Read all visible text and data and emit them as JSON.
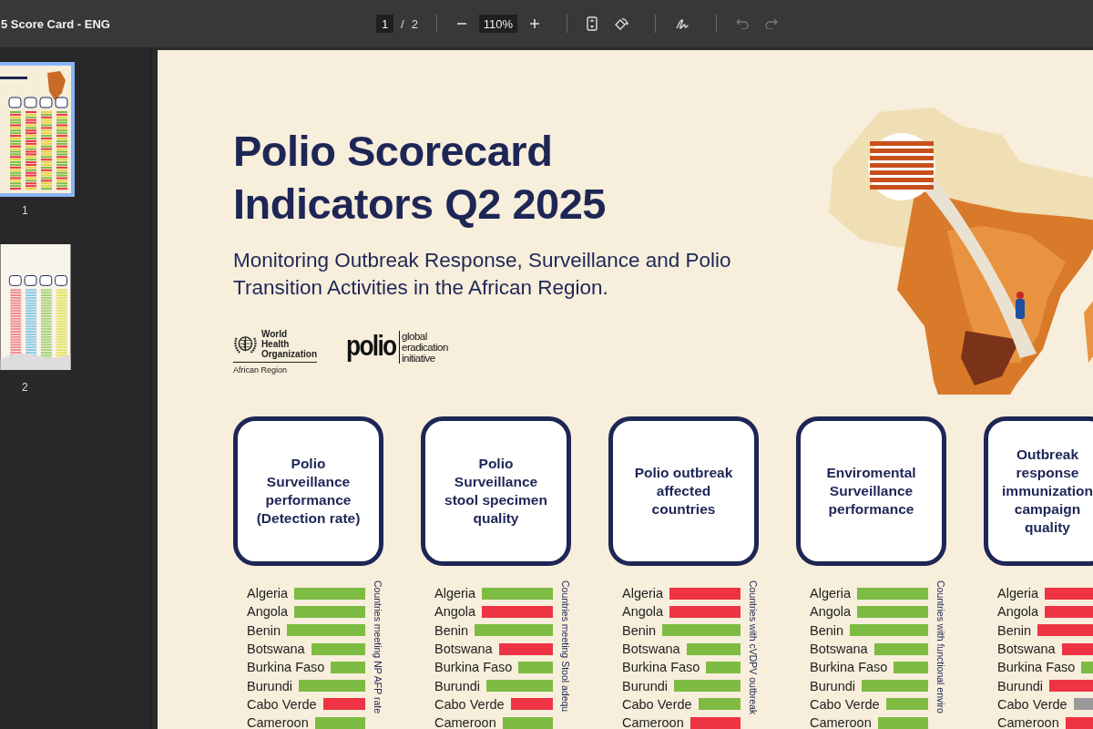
{
  "toolbar": {
    "title": "5 Score Card - ENG",
    "page_input": "1",
    "page_separator": "/",
    "page_count": "2",
    "zoom": "110%",
    "undo_disabled": true,
    "redo_disabled": true
  },
  "thumbnails": [
    {
      "label": "1",
      "selected": true
    },
    {
      "label": "2",
      "selected": false
    }
  ],
  "document": {
    "title_lines": [
      "Polio Scorecard",
      "Indicators Q2 2025"
    ],
    "subtitle_lines": [
      "Monitoring Outbreak Response, Surveillance and Polio",
      "Transition Activities in the African Region."
    ],
    "who_logo": {
      "name_lines": [
        "World Health",
        "Organization"
      ],
      "region": "African Region"
    },
    "gpei_logo": {
      "mark": "polio",
      "name_lines": [
        "global",
        "eradication",
        "initiative"
      ]
    },
    "columns": [
      {
        "title": "Polio Surveillance performance (Detection rate)",
        "side_note": "Countries meeting NP AFP rate",
        "rows": [
          {
            "name": "Algeria",
            "color": "#7dbb42"
          },
          {
            "name": "Angola",
            "color": "#7dbb42"
          },
          {
            "name": "Benin",
            "color": "#7dbb42"
          },
          {
            "name": "Botswana",
            "color": "#7dbb42"
          },
          {
            "name": "Burkina Faso",
            "color": "#7dbb42"
          },
          {
            "name": "Burundi",
            "color": "#7dbb42"
          },
          {
            "name": "Cabo Verde",
            "color": "#ee3444"
          },
          {
            "name": "Cameroon",
            "color": "#7dbb42"
          }
        ]
      },
      {
        "title": "Polio Surveillance stool specimen quality",
        "side_note": "Countries meeting Stool adequ",
        "rows": [
          {
            "name": "Algeria",
            "color": "#7dbb42"
          },
          {
            "name": "Angola",
            "color": "#ee3444"
          },
          {
            "name": "Benin",
            "color": "#7dbb42"
          },
          {
            "name": "Botswana",
            "color": "#ee3444"
          },
          {
            "name": "Burkina Faso",
            "color": "#7dbb42"
          },
          {
            "name": "Burundi",
            "color": "#7dbb42"
          },
          {
            "name": "Cabo Verde",
            "color": "#ee3444"
          },
          {
            "name": "Cameroon",
            "color": "#7dbb42"
          }
        ]
      },
      {
        "title": "Polio outbreak affected countries",
        "side_note": "Countries with cVDPV outbreak",
        "rows": [
          {
            "name": "Algeria",
            "color": "#ee3444"
          },
          {
            "name": "Angola",
            "color": "#ee3444"
          },
          {
            "name": "Benin",
            "color": "#7dbb42"
          },
          {
            "name": "Botswana",
            "color": "#7dbb42"
          },
          {
            "name": "Burkina Faso",
            "color": "#7dbb42"
          },
          {
            "name": "Burundi",
            "color": "#7dbb42"
          },
          {
            "name": "Cabo Verde",
            "color": "#7dbb42"
          },
          {
            "name": "Cameroon",
            "color": "#ee3444"
          }
        ]
      },
      {
        "title": "Enviromental Surveillance performance",
        "side_note": "Countries with functional enviro",
        "rows": [
          {
            "name": "Algeria",
            "color": "#7dbb42"
          },
          {
            "name": "Angola",
            "color": "#7dbb42"
          },
          {
            "name": "Benin",
            "color": "#7dbb42"
          },
          {
            "name": "Botswana",
            "color": "#7dbb42"
          },
          {
            "name": "Burkina Faso",
            "color": "#7dbb42"
          },
          {
            "name": "Burundi",
            "color": "#7dbb42"
          },
          {
            "name": "Cabo Verde",
            "color": "#7dbb42"
          },
          {
            "name": "Cameroon",
            "color": "#7dbb42"
          }
        ]
      },
      {
        "title": "Outbreak response immunization campaign quality",
        "rows": [
          {
            "name": "Algeria",
            "color": "#ee3444"
          },
          {
            "name": "Angola",
            "color": "#ee3444"
          },
          {
            "name": "Benin",
            "color": "#ee3444"
          },
          {
            "name": "Botswana",
            "color": "#ee3444"
          },
          {
            "name": "Burkina Faso",
            "color": "#7dbb42"
          },
          {
            "name": "Burundi",
            "color": "#ee3444"
          },
          {
            "name": "Cabo Verde",
            "color": "#9a9a9a"
          },
          {
            "name": "Cameroon",
            "color": "#ee3444"
          }
        ]
      }
    ]
  }
}
